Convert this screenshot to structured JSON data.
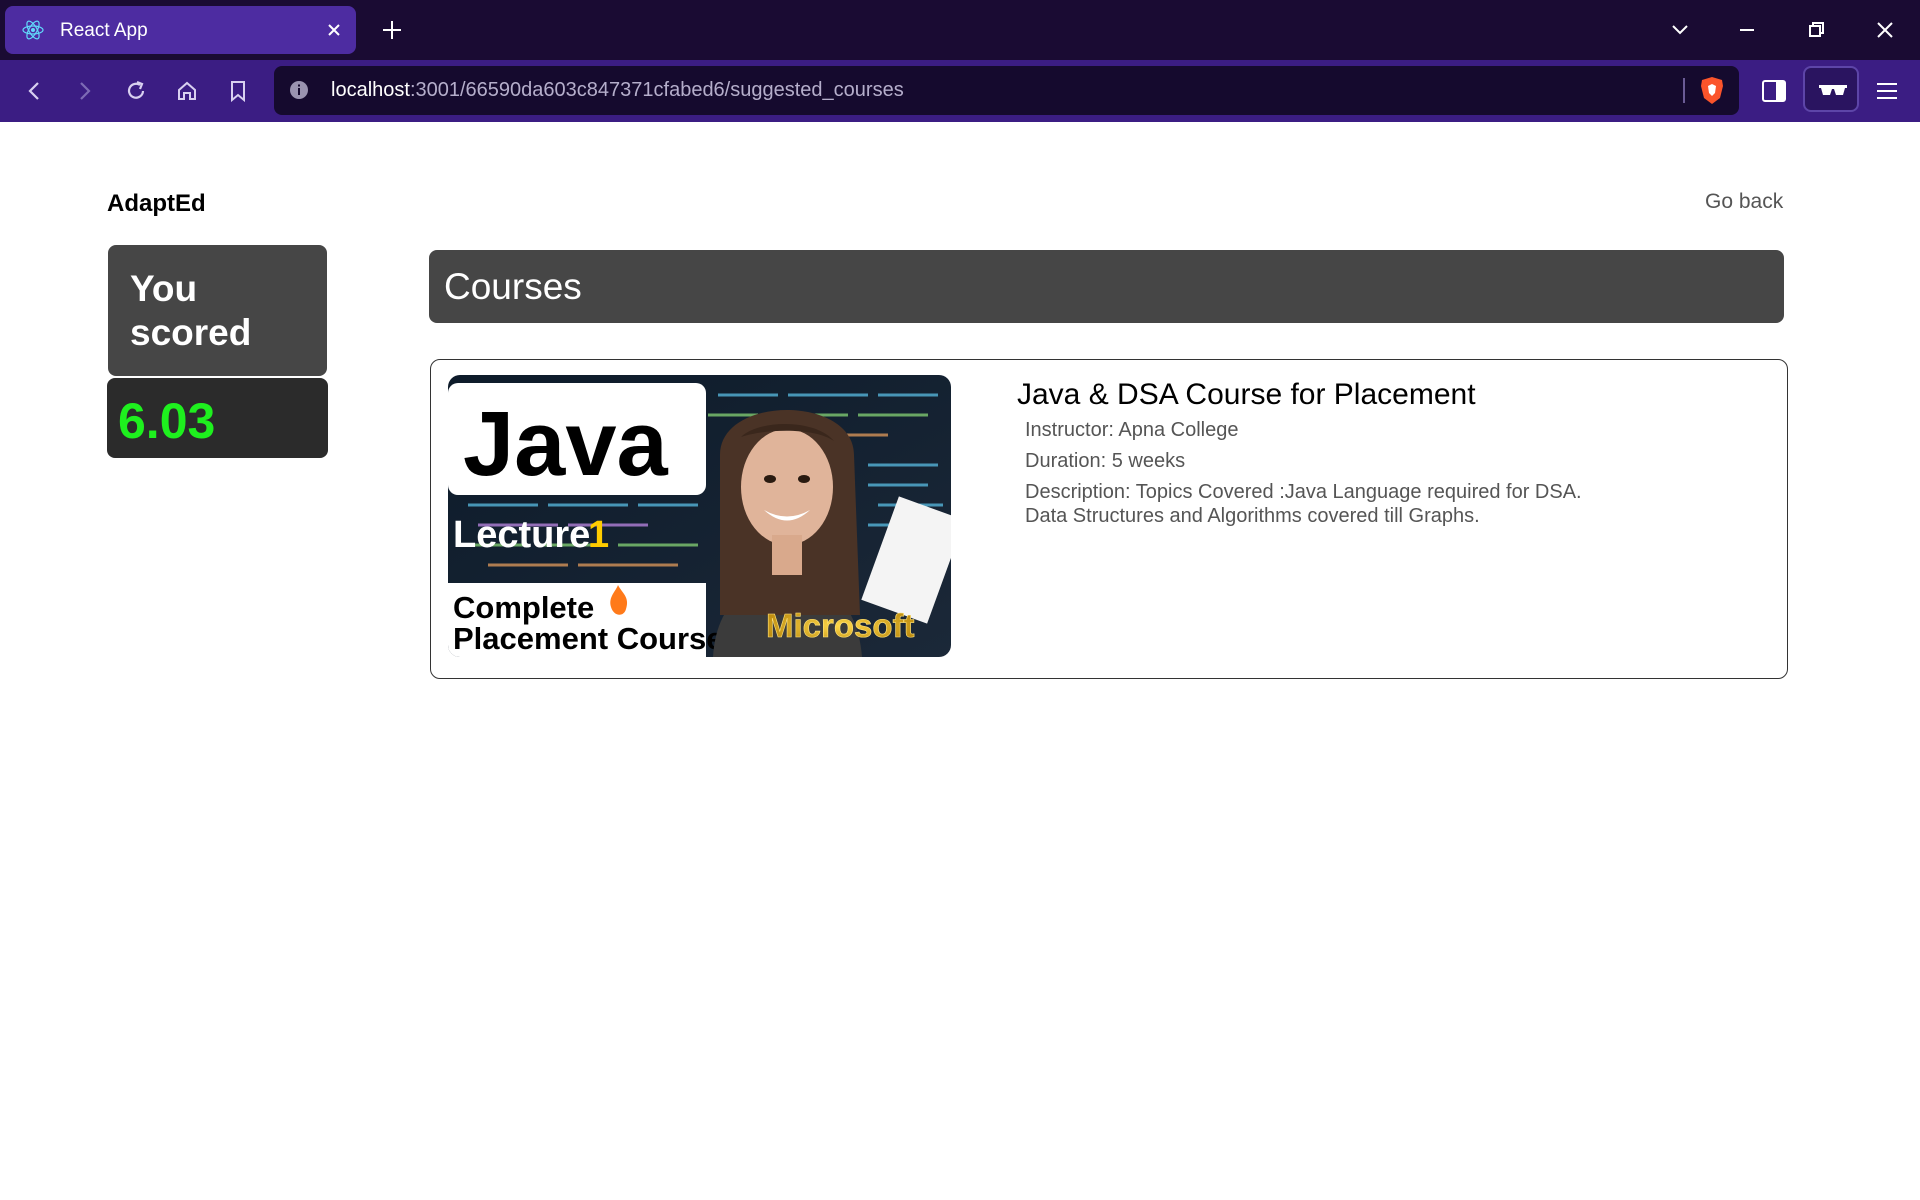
{
  "browser": {
    "tab_title": "React App",
    "url_host": "localhost",
    "url_rest": ":3001/66590da603c847371cfabed6/suggested_courses"
  },
  "header": {
    "brand": "AdaptEd",
    "go_back": "Go back"
  },
  "score": {
    "label": "You scored",
    "value": "6.03",
    "value_color": "#1ef01e"
  },
  "courses": {
    "title": "Courses",
    "items": [
      {
        "title": "Java & DSA Course for Placement",
        "instructor": "Instructor: Apna College",
        "duration": "Duration: 5 weeks",
        "description": "Description: Topics Covered :Java Language required for DSA. Data Structures and Algorithms covered till Graphs.",
        "thumbnail": {
          "java": "Java",
          "lecture": "Lecture",
          "lecture_num": "1",
          "complete_line1": "Complete",
          "complete_line2": "Placement Course",
          "company": "Microsoft"
        }
      }
    ]
  },
  "colors": {
    "titlebar": "#1a0b33",
    "navbar": "#3b1d83",
    "active_tab": "#4d2ca1",
    "panel": "#464646"
  }
}
